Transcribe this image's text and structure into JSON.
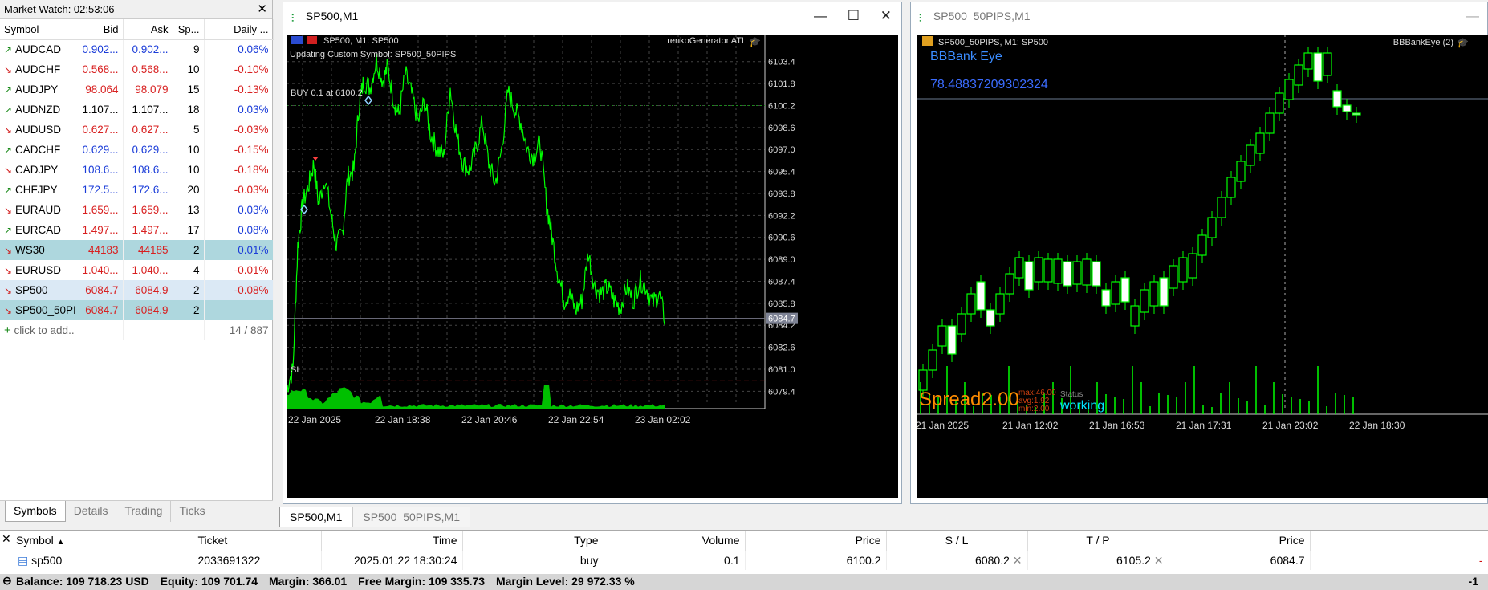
{
  "market_watch": {
    "title": "Market Watch: 02:53:06",
    "columns": [
      "Symbol",
      "Bid",
      "Ask",
      "Sp...",
      "Daily ..."
    ],
    "rows": [
      {
        "symbol": "AUDCAD",
        "dir": "up",
        "bid": "0.902...",
        "ask": "0.902...",
        "spread": "9",
        "daily": "0.06%",
        "color": "blue",
        "sel": ""
      },
      {
        "symbol": "AUDCHF",
        "dir": "down",
        "bid": "0.568...",
        "ask": "0.568...",
        "spread": "10",
        "daily": "-0.10%",
        "color": "red",
        "sel": ""
      },
      {
        "symbol": "AUDJPY",
        "dir": "up",
        "bid": "98.064",
        "ask": "98.079",
        "spread": "15",
        "daily": "-0.13%",
        "color": "red",
        "sel": ""
      },
      {
        "symbol": "AUDNZD",
        "dir": "up",
        "bid": "1.107...",
        "ask": "1.107...",
        "spread": "18",
        "daily": "0.03%",
        "color": "black",
        "sel": ""
      },
      {
        "symbol": "AUDUSD",
        "dir": "down",
        "bid": "0.627...",
        "ask": "0.627...",
        "spread": "5",
        "daily": "-0.03%",
        "color": "red",
        "sel": ""
      },
      {
        "symbol": "CADCHF",
        "dir": "up",
        "bid": "0.629...",
        "ask": "0.629...",
        "spread": "10",
        "daily": "-0.15%",
        "color": "blue",
        "sel": ""
      },
      {
        "symbol": "CADJPY",
        "dir": "down",
        "bid": "108.6...",
        "ask": "108.6...",
        "spread": "10",
        "daily": "-0.18%",
        "color": "blue",
        "sel": ""
      },
      {
        "symbol": "CHFJPY",
        "dir": "up",
        "bid": "172.5...",
        "ask": "172.6...",
        "spread": "20",
        "daily": "-0.03%",
        "color": "blue",
        "sel": ""
      },
      {
        "symbol": "EURAUD",
        "dir": "down",
        "bid": "1.659...",
        "ask": "1.659...",
        "spread": "13",
        "daily": "0.03%",
        "color": "red",
        "sel": ""
      },
      {
        "symbol": "EURCAD",
        "dir": "up",
        "bid": "1.497...",
        "ask": "1.497...",
        "spread": "17",
        "daily": "0.08%",
        "color": "red",
        "sel": ""
      },
      {
        "symbol": "WS30",
        "dir": "down",
        "bid": "44183",
        "ask": "44185",
        "spread": "2",
        "daily": "0.01%",
        "color": "red",
        "sel": "row-sel"
      },
      {
        "symbol": "EURUSD",
        "dir": "down",
        "bid": "1.040...",
        "ask": "1.040...",
        "spread": "4",
        "daily": "-0.01%",
        "color": "red",
        "sel": ""
      },
      {
        "symbol": "SP500",
        "dir": "down",
        "bid": "6084.7",
        "ask": "6084.9",
        "spread": "2",
        "daily": "-0.08%",
        "color": "red",
        "sel": "row-sel2"
      },
      {
        "symbol": "SP500_50PI...",
        "dir": "down",
        "bid": "6084.7",
        "ask": "6084.9",
        "spread": "2",
        "daily": "",
        "color": "red",
        "sel": "row-sel"
      }
    ],
    "add_label": "click to add...",
    "count": "14 / 887",
    "tabs": [
      "Symbols",
      "Details",
      "Trading",
      "Ticks"
    ]
  },
  "chart1": {
    "window_title": "SP500,M1",
    "header": "SP500, M1:  SP500",
    "subheader": "Updating Custom Symbol: SP500_50PIPS",
    "indicator": "renkoGenerator ATI",
    "buy_label": "BUY 0.1 at 6100.2",
    "sl_label": "SL",
    "current_price": "6084.7",
    "y_ticks": [
      "6103.4",
      "6101.8",
      "6100.2",
      "6098.6",
      "6097.0",
      "6095.4",
      "6093.8",
      "6092.2",
      "6090.6",
      "6089.0",
      "6087.4",
      "6085.8",
      "6084.2",
      "6082.6",
      "6081.0",
      "6079.4"
    ],
    "x_ticks": [
      "22 Jan 2025",
      "22 Jan 18:38",
      "22 Jan 20:46",
      "22 Jan 22:54",
      "23 Jan 02:02"
    ]
  },
  "chart2": {
    "window_title": "SP500_50PIPS,M1",
    "header": "SP500_50PIPS, M1:  SP500",
    "indicator": "BBBankEye (2)",
    "eye_title": "BBBank Eye",
    "eye_value": "78.48837209302324",
    "spread_label": "Spread",
    "spread_value": "2.00",
    "max_label": "max:46.00",
    "avg_label": "avg:1.92",
    "min_label": "min:2.00",
    "status_label": "Status",
    "status_value": "working",
    "x_ticks": [
      "21 Jan 2025",
      "21 Jan 12:02",
      "21 Jan 16:53",
      "21 Jan 17:31",
      "21 Jan 23:02",
      "22 Jan 18:30"
    ]
  },
  "chart_tabs": [
    "SP500,M1",
    "SP500_50PIPS,M1"
  ],
  "trade": {
    "columns": [
      "Symbol",
      "Ticket",
      "Time",
      "Type",
      "Volume",
      "Price",
      "S / L",
      "T / P",
      "Price"
    ],
    "row": {
      "symbol": "sp500",
      "ticket": "2033691322",
      "time": "2025.01.22 18:30:24",
      "type": "buy",
      "volume": "0.1",
      "price": "6100.2",
      "sl": "6080.2",
      "tp": "6105.2",
      "cur_price": "6084.7"
    }
  },
  "balance": {
    "balance": "Balance: 109 718.23 USD",
    "equity": "Equity: 109 701.74",
    "margin": "Margin: 366.01",
    "free_margin": "Free Margin: 109 335.73",
    "margin_level": "Margin Level: 29 972.33 %",
    "trailing": "-1"
  },
  "colors": {
    "green": "#00ff00",
    "grid": "#555555",
    "blue_label": "#3b6cff",
    "orange": "#ff8c00",
    "cyan": "#00e5ff"
  }
}
